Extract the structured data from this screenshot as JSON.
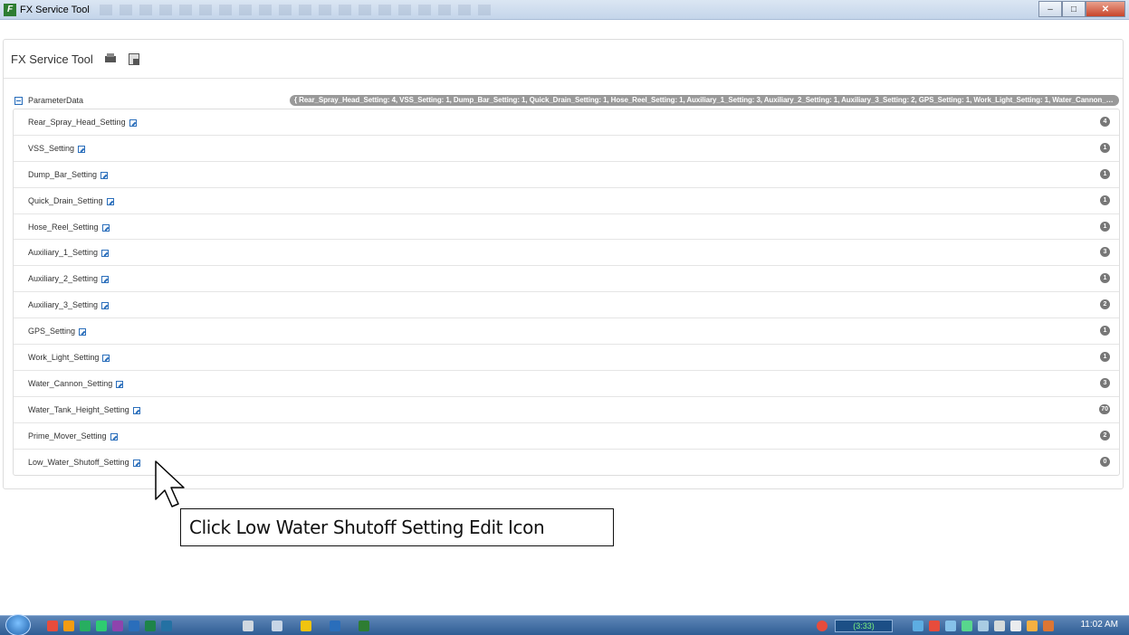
{
  "window": {
    "title": "FX Service Tool",
    "controls": {
      "minimize": "–",
      "maximize": "□",
      "close": "✕"
    }
  },
  "header": {
    "app_name": "FX Service Tool",
    "icons": [
      "printer-icon",
      "export-icon"
    ]
  },
  "parameter_data": {
    "label": "ParameterData",
    "summary": "{ Rear_Spray_Head_Setting: 4, VSS_Setting: 1, Dump_Bar_Setting: 1, Quick_Drain_Setting: 1, Hose_Reel_Setting: 1, Auxiliary_1_Setting: 3, Auxiliary_2_Setting: 1, Auxiliary_3_Setting: 2, GPS_Setting: 1, Work_Light_Setting: 1, Water_Cannon_Setti…",
    "items": [
      {
        "label": "Rear_Spray_Head_Setting",
        "value": "4"
      },
      {
        "label": "VSS_Setting",
        "value": "1"
      },
      {
        "label": "Dump_Bar_Setting",
        "value": "1"
      },
      {
        "label": "Quick_Drain_Setting",
        "value": "1"
      },
      {
        "label": "Hose_Reel_Setting",
        "value": "1"
      },
      {
        "label": "Auxiliary_1_Setting",
        "value": "3"
      },
      {
        "label": "Auxiliary_2_Setting",
        "value": "1"
      },
      {
        "label": "Auxiliary_3_Setting",
        "value": "2"
      },
      {
        "label": "GPS_Setting",
        "value": "1"
      },
      {
        "label": "Work_Light_Setting",
        "value": "1"
      },
      {
        "label": "Water_Cannon_Setting",
        "value": "3"
      },
      {
        "label": "Water_Tank_Height_Setting",
        "value": "70"
      },
      {
        "label": "Prime_Mover_Setting",
        "value": "2"
      },
      {
        "label": "Low_Water_Shutoff_Setting",
        "value": "0"
      }
    ]
  },
  "annotation": {
    "text": "Click Low Water Shutoff Setting Edit Icon"
  },
  "taskbar": {
    "battery": "(3:33)",
    "clock": "11:02 AM"
  }
}
